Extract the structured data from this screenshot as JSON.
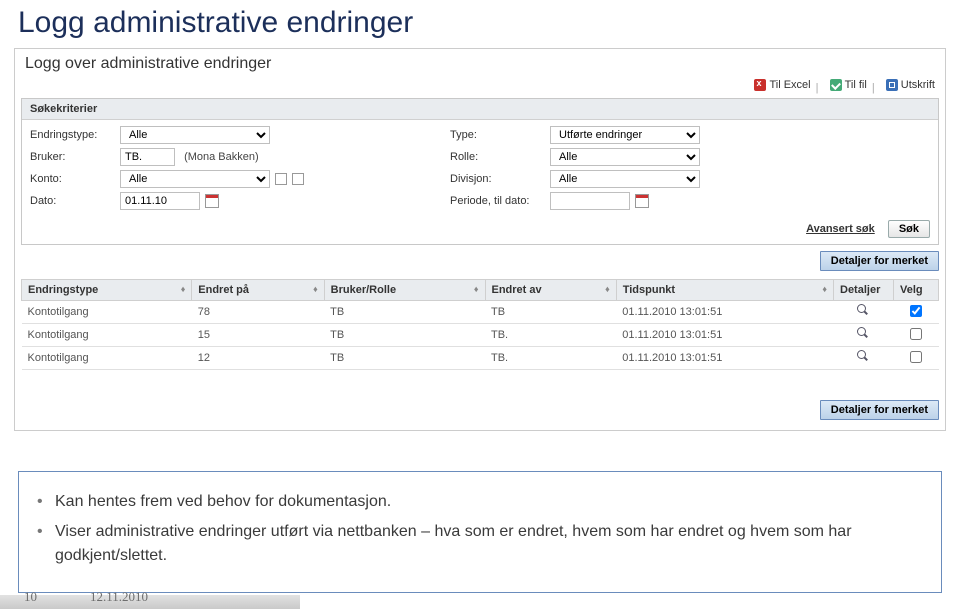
{
  "slide_title": "Logg administrative endringer",
  "panel_title": "Logg over administrative endringer",
  "toolbar": {
    "excel": "Til Excel",
    "til_fil": "Til fil",
    "utskrift": "Utskrift"
  },
  "search": {
    "header": "Søkekriterier",
    "labels": {
      "endringstype": "Endringstype:",
      "type": "Type:",
      "bruker": "Bruker:",
      "rolle": "Rolle:",
      "konto": "Konto:",
      "divisjon": "Divisjon:",
      "dato": "Dato:",
      "periode": "Periode, til dato:"
    },
    "values": {
      "endringstype": "Alle",
      "type": "Utførte endringer",
      "bruker_code": "TB.",
      "bruker_name": "(Mona Bakken)",
      "rolle": "Alle",
      "konto": "Alle",
      "divisjon": "Alle",
      "dato": "01.11.10",
      "periode": ""
    },
    "advanced": "Avansert søk",
    "search_btn": "Søk"
  },
  "detail_btn": "Detaljer for merket",
  "table": {
    "headers": {
      "endringstype": "Endringstype",
      "endret_pa": "Endret på",
      "bruker_rolle": "Bruker/Rolle",
      "endret_av": "Endret av",
      "tidspunkt": "Tidspunkt",
      "detaljer": "Detaljer",
      "velg": "Velg"
    },
    "rows": [
      {
        "type": "Kontotilgang",
        "endret_pa": "78",
        "bruker": "TB",
        "endret_av": "TB",
        "tid": "01.11.2010 13:01:51",
        "checked": true
      },
      {
        "type": "Kontotilgang",
        "endret_pa": "15",
        "bruker": "TB",
        "endret_av": "TB.",
        "tid": "01.11.2010 13:01:51",
        "checked": false
      },
      {
        "type": "Kontotilgang",
        "endret_pa": "12",
        "bruker": "TB",
        "endret_av": "TB.",
        "tid": "01.11.2010 13:01:51",
        "checked": false
      }
    ]
  },
  "notes": {
    "b1": "Kan hentes frem ved behov for dokumentasjon.",
    "b2": "Viser administrative endringer utført via nettbanken – hva som er endret, hvem som har endret og hvem som har godkjent/slettet."
  },
  "footer": {
    "page": "10",
    "date": "12.11.2010"
  }
}
